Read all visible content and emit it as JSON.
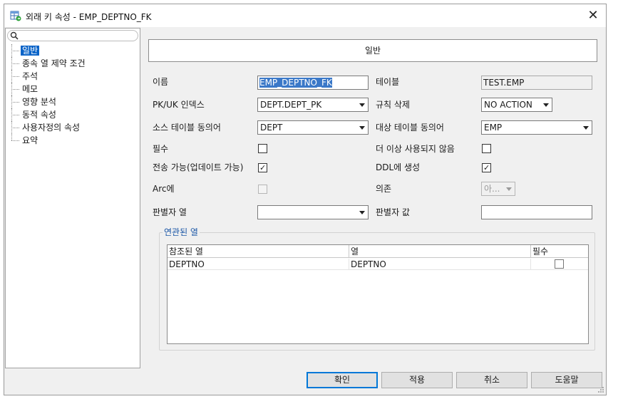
{
  "window": {
    "title": "외래 키 속성 - EMP_DEPTNO_FK",
    "close_glyph": "✕",
    "icon": "app-table-icon"
  },
  "search": {
    "placeholder": ""
  },
  "tree": {
    "items": [
      {
        "label": "일반",
        "selected": true
      },
      {
        "label": "종속 열 제약 조건"
      },
      {
        "label": "주석"
      },
      {
        "label": "메모"
      },
      {
        "label": "영향 분석"
      },
      {
        "label": "동적 속성"
      },
      {
        "label": "사용자정의 속성"
      },
      {
        "label": "요약"
      }
    ]
  },
  "section": {
    "header": "일반"
  },
  "form": {
    "name_label": "이름",
    "name_value": "EMP_DEPTNO_FK",
    "table_label": "테이블",
    "table_value": "TEST.EMP",
    "pkuk_label": "PK/UK 인덱스",
    "pkuk_value": "DEPT.DEPT_PK",
    "delete_rule_label": "규칙 삭제",
    "delete_rule_value": "NO ACTION",
    "source_syn_label": "소스 테이블 동의어",
    "source_syn_value": "DEPT",
    "target_syn_label": "대상 테이블 동의어",
    "target_syn_value": "EMP",
    "mandatory_label": "필수",
    "mandatory_checked": false,
    "deprecated_label": "더 이상 사용되지 않음",
    "deprecated_checked": false,
    "transferable_label": "전송 가능(업데이트 가능)",
    "transferable_checked": true,
    "in_ddl_label": "DDL에 생성",
    "in_ddl_checked": true,
    "arc_label": "Arc에",
    "arc_checked": false,
    "dependency_label": "의존",
    "dependency_value": "아...",
    "discriminator_col_label": "판별자 열",
    "discriminator_col_value": "",
    "discriminator_val_label": "판별자 값",
    "discriminator_val_value": ""
  },
  "related_columns": {
    "legend": "연관된 열",
    "headers": [
      "참조된 열",
      "열",
      "필수"
    ],
    "rows": [
      {
        "referenced": "DEPTNO",
        "column": "DEPTNO",
        "mandatory": false
      }
    ]
  },
  "buttons": {
    "ok": "확인",
    "apply": "적용",
    "cancel": "취소",
    "help": "도움말"
  },
  "colors": {
    "selection": "#0a64c8",
    "legend_text": "#1a56a6",
    "default_button_border": "#0078d7"
  }
}
